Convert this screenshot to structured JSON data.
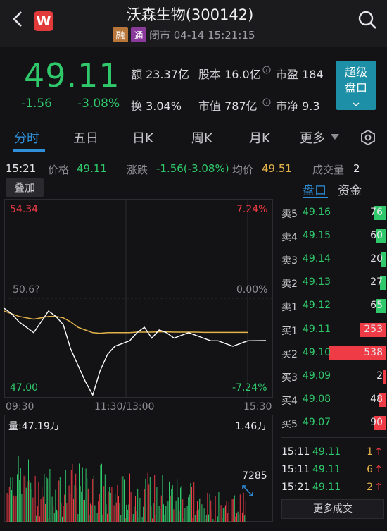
{
  "header": {
    "title": "沃森生物(300142)",
    "tag1": "融",
    "tag2": "通",
    "status": "闭市 04-14 15:21:15",
    "logo": "W",
    "back_icon": "chevron-left-icon",
    "search_icon": "search-icon"
  },
  "quote": {
    "price": "49.11",
    "change": "-1.56",
    "change_pct": "-3.08%",
    "amount_label": "额",
    "amount": "23.37亿",
    "shares_label": "股本",
    "shares": "16.0亿",
    "pe_label": "市盈",
    "pe": "184",
    "turnover_label": "换",
    "turnover": "3.04%",
    "mcap_label": "市值",
    "mcap": "787亿",
    "pb_label": "市净",
    "pb": "9.3",
    "super_btn_line1": "超级",
    "super_btn_line2": "盘口"
  },
  "tabs": [
    "分时",
    "五日",
    "日K",
    "周K",
    "月K",
    "更多"
  ],
  "info": {
    "time": "15:21",
    "price_label": "价格",
    "price": "49.11",
    "chg_label": "涨跌",
    "chg": "-1.56(-3.08%)",
    "avg_label": "均价",
    "avg": "49.51",
    "vol_label": "成交量",
    "vol": "2"
  },
  "chart": {
    "add_btn": "叠加",
    "y_top": "54.34",
    "y_mid": "50.6?",
    "y_bot": "47.00",
    "pct_top": "7.24%",
    "pct_mid": "0.00%",
    "pct_bot": "-7.24%",
    "x_start": "09:30",
    "x_mid": "11:30/13:00",
    "x_end": "15:30",
    "vol_label": "量:47.19万",
    "vol_max": "1.46万",
    "vol_last": "7285",
    "colors": {
      "price": "#ffffff",
      "avg": "#e3b34a",
      "up": "#ee3b45",
      "down": "#2fc96b"
    }
  },
  "chart_data": {
    "type": "line",
    "series": [
      {
        "values": [
          50.3,
          50.1,
          49.8,
          49.6,
          49.4,
          49.8,
          50.2,
          50.0,
          49.7,
          48.8,
          48.2,
          47.6,
          47.1,
          48.0,
          48.6,
          48.9,
          49.0,
          49.1,
          49.4,
          49.6,
          49.2,
          49.5,
          49.4,
          49.2,
          49.3,
          49.4,
          49.3,
          49.2,
          49.1,
          49.1,
          49.0,
          48.9,
          49.0,
          49.1
        ]
      },
      {
        "values": [
          50.2,
          50.1,
          50.0,
          49.95,
          49.9,
          49.95,
          50.0,
          50.0,
          49.95,
          49.8,
          49.6,
          49.5,
          49.4,
          49.38,
          49.4,
          49.4,
          49.4,
          49.4,
          49.42,
          49.42,
          49.42,
          49.43,
          49.43,
          49.42,
          49.42,
          49.42,
          49.42,
          49.41,
          49.41,
          49.41,
          49.41,
          49.41,
          49.41,
          49.41
        ]
      }
    ],
    "ylim": [
      47.0,
      54.34
    ],
    "x_ticks": [
      "09:30",
      "11:30/13:00",
      "15:30"
    ]
  },
  "book": {
    "tab_active": "盘口",
    "tab_other": "资金",
    "asks": [
      {
        "label": "卖5",
        "price": "49.16",
        "vol": "76",
        "bar": 0.08
      },
      {
        "label": "卖4",
        "price": "49.15",
        "vol": "60",
        "bar": 0.06
      },
      {
        "label": "卖3",
        "price": "49.14",
        "vol": "20",
        "bar": 0.02
      },
      {
        "label": "卖2",
        "price": "49.13",
        "vol": "27",
        "bar": 0.03
      },
      {
        "label": "卖1",
        "price": "49.12",
        "vol": "65",
        "bar": 0.07
      }
    ],
    "bids": [
      {
        "label": "买1",
        "price": "49.11",
        "vol": "253",
        "bar": 0.22
      },
      {
        "label": "买2",
        "price": "49.10",
        "vol": "538",
        "bar": 0.52
      },
      {
        "label": "买3",
        "price": "49.09",
        "vol": "2",
        "bar": 0.0
      },
      {
        "label": "买4",
        "price": "49.08",
        "vol": "48",
        "bar": 0.04
      },
      {
        "label": "买5",
        "price": "49.07",
        "vol": "90",
        "bar": 0.08
      }
    ],
    "trades": [
      {
        "time": "15:11",
        "price": "49.11",
        "vol": "1",
        "arrow": "↑"
      },
      {
        "time": "15:11",
        "price": "49.11",
        "vol": "6",
        "arrow": "↑"
      },
      {
        "time": "15:21",
        "price": "49.11",
        "vol": "2",
        "arrow": "↑"
      }
    ],
    "more_btn": "更多成交"
  }
}
